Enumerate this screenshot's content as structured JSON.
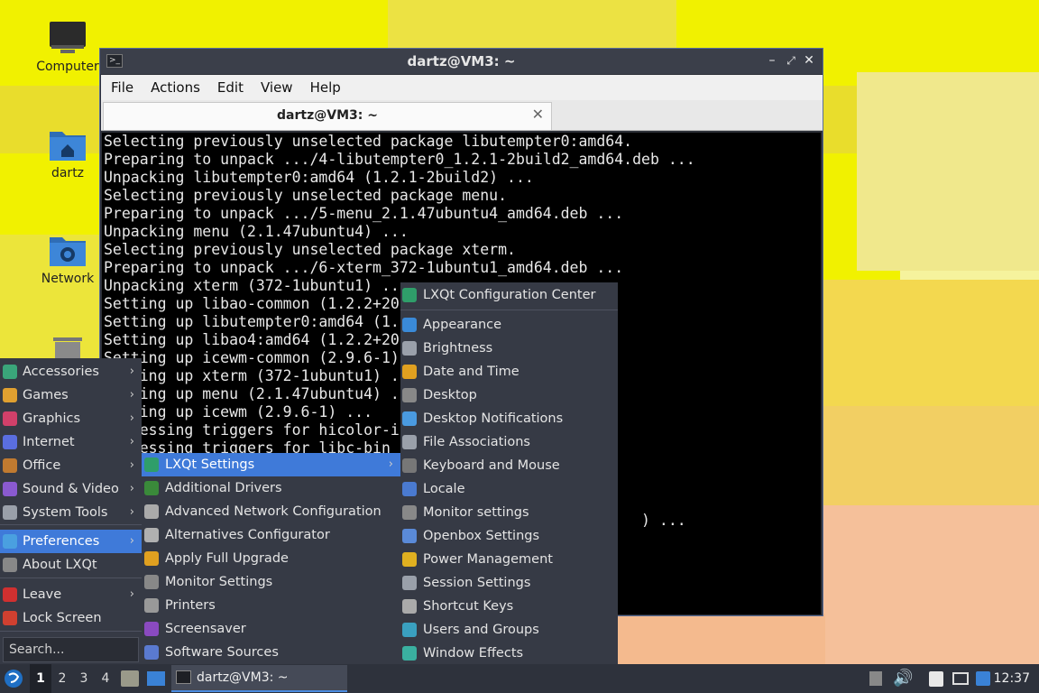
{
  "desktop": {
    "icons": [
      {
        "label": "Computer"
      },
      {
        "label": "dartz"
      },
      {
        "label": "Network"
      }
    ]
  },
  "window": {
    "title": "dartz@VM3: ~",
    "menubar": [
      "File",
      "Actions",
      "Edit",
      "View",
      "Help"
    ],
    "tab_title": "dartz@VM3: ~",
    "terminal_lines": [
      "Selecting previously unselected package libutempter0:amd64.",
      "Preparing to unpack .../4-libutempter0_1.2.1-2build2_amd64.deb ...",
      "Unpacking libutempter0:amd64 (1.2.1-2build2) ...",
      "Selecting previously unselected package menu.",
      "Preparing to unpack .../5-menu_2.1.47ubuntu4_amd64.deb ...",
      "Unpacking menu (2.1.47ubuntu4) ...",
      "Selecting previously unselected package xterm.",
      "Preparing to unpack .../6-xterm_372-1ubuntu1_amd64.deb ...",
      "Unpacking xterm (372-1ubuntu1) ...",
      "Setting up libao-common (1.2.2+20",
      "Setting up libutempter0:amd64 (1.",
      "Setting up libao4:amd64 (1.2.2+20",
      "Setting up icewm-common (2.9.6-1)",
      "Setting up xterm (372-1ubuntu1) .",
      "Setting up menu (2.1.47ubuntu4) .",
      "Setting up icewm (2.9.6-1) ...",
      "Processing triggers for hicolor-i",
      "Processing triggers for libc-bin",
      "",
      "",
      "",
      "                                                            ) ..."
    ]
  },
  "main_menu": {
    "items": [
      {
        "label": "Accessories",
        "arrow": "›",
        "color": "#3aa57a"
      },
      {
        "label": "Games",
        "arrow": "›",
        "color": "#e0a030"
      },
      {
        "label": "Graphics",
        "arrow": "›",
        "color": "#d0406a"
      },
      {
        "label": "Internet",
        "arrow": "›",
        "color": "#5a6ee0"
      },
      {
        "label": "Office",
        "arrow": "›",
        "color": "#c07a30"
      },
      {
        "label": "Sound & Video",
        "arrow": "›",
        "color": "#8a5ad0"
      },
      {
        "label": "System Tools",
        "arrow": "›",
        "color": "#9aa0aa"
      },
      {
        "label": "Preferences",
        "arrow": "›",
        "color": "#4aa0e0"
      },
      {
        "label": "About LXQt",
        "arrow": "",
        "color": "#888888"
      },
      {
        "label": "Leave",
        "arrow": "›",
        "color": "#d03030"
      },
      {
        "label": "Lock Screen",
        "arrow": "",
        "color": "#d04030"
      }
    ],
    "search_placeholder": "Search..."
  },
  "preferences_menu": {
    "items": [
      {
        "label": "LXQt Settings",
        "arrow": "›",
        "color": "#2f9e6a"
      },
      {
        "label": "Additional Drivers",
        "arrow": "",
        "color": "#3a8a3a"
      },
      {
        "label": "Advanced Network Configuration",
        "arrow": "",
        "color": "#aaaaaa"
      },
      {
        "label": "Alternatives Configurator",
        "arrow": "",
        "color": "#b0b0b0"
      },
      {
        "label": "Apply Full Upgrade",
        "arrow": "",
        "color": "#e0a020"
      },
      {
        "label": "Monitor Settings",
        "arrow": "",
        "color": "#888888"
      },
      {
        "label": "Printers",
        "arrow": "",
        "color": "#999999"
      },
      {
        "label": "Screensaver",
        "arrow": "",
        "color": "#8a4ac0"
      },
      {
        "label": "Software Sources",
        "arrow": "",
        "color": "#5a7ad0"
      }
    ]
  },
  "lxqt_settings_menu": {
    "items": [
      {
        "label": "LXQt Configuration Center",
        "color": "#2f9e6a"
      },
      {
        "label": "Appearance",
        "color": "#3a8ad8"
      },
      {
        "label": "Brightness",
        "color": "#9aa0aa"
      },
      {
        "label": "Date and Time",
        "color": "#e0a020"
      },
      {
        "label": "Desktop",
        "color": "#888888"
      },
      {
        "label": "Desktop Notifications",
        "color": "#4a9ae0"
      },
      {
        "label": "File Associations",
        "color": "#9aa0aa"
      },
      {
        "label": "Keyboard and Mouse",
        "color": "#777777"
      },
      {
        "label": "Locale",
        "color": "#4a7ad0"
      },
      {
        "label": "Monitor settings",
        "color": "#888888"
      },
      {
        "label": "Openbox Settings",
        "color": "#5a8ad8"
      },
      {
        "label": "Power Management",
        "color": "#e0b020"
      },
      {
        "label": "Session Settings",
        "color": "#9aa0aa"
      },
      {
        "label": "Shortcut Keys",
        "color": "#aaaaaa"
      },
      {
        "label": "Users and Groups",
        "color": "#3aa0c0"
      },
      {
        "label": "Window Effects",
        "color": "#3ab0a0"
      }
    ]
  },
  "taskbar": {
    "desktops": [
      "1",
      "2",
      "3",
      "4"
    ],
    "task_title": "dartz@VM3: ~",
    "clock": "12:37"
  }
}
